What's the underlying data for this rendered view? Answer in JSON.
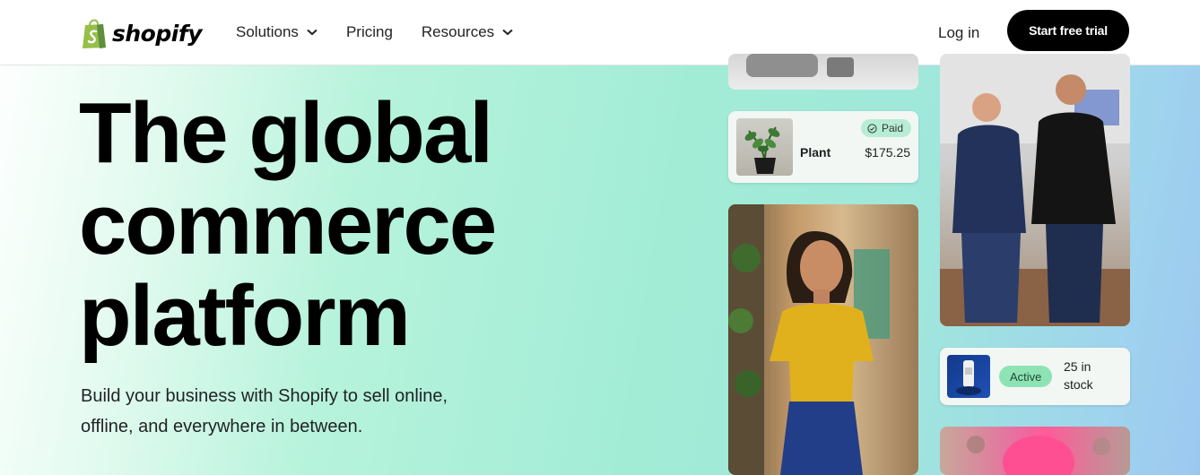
{
  "header": {
    "brand": "shopify",
    "nav": [
      {
        "label": "Solutions",
        "has_dropdown": true
      },
      {
        "label": "Pricing",
        "has_dropdown": false
      },
      {
        "label": "Resources",
        "has_dropdown": true
      }
    ],
    "login_label": "Log in",
    "cta_label": "Start free trial",
    "brand_color": "#95bf47"
  },
  "hero": {
    "headline_lines": [
      "The global",
      "commerce",
      "platform"
    ],
    "subtext_lines": [
      "Build your business with Shopify to sell online,",
      "offline, and everywhere in between."
    ]
  },
  "collage": {
    "order_card": {
      "status": "Paid",
      "status_icon": "check-circle-icon",
      "product": "Plant",
      "price": "$175.25"
    },
    "inventory_card": {
      "status": "Active",
      "stock_text": "25 in stock"
    }
  }
}
